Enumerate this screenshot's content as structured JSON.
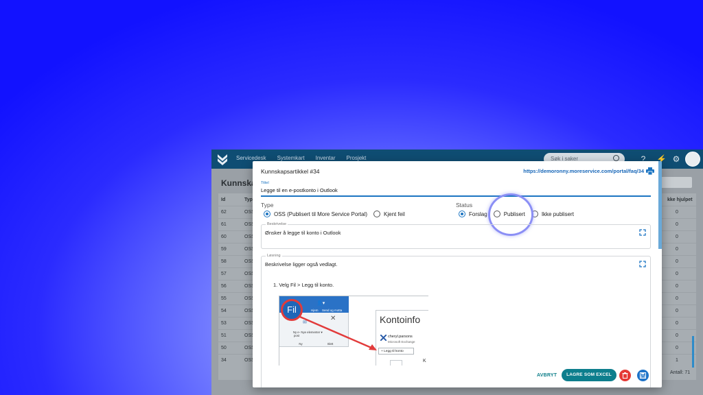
{
  "app": {
    "nav": [
      "Servicedesk",
      "Systemkart",
      "Inventar",
      "Prosjekt"
    ],
    "search_placeholder": "Søk i saker",
    "page_title": "Kunnskap",
    "table": {
      "headers": [
        "Id",
        "Typ",
        "kke hjulpet"
      ],
      "rows": [
        {
          "id": "62",
          "type": "OSS",
          "val": "0"
        },
        {
          "id": "61",
          "type": "OSS",
          "val": "0"
        },
        {
          "id": "60",
          "type": "OSS",
          "val": "0"
        },
        {
          "id": "59",
          "type": "OSS",
          "val": "0"
        },
        {
          "id": "58",
          "type": "OSS",
          "val": "0"
        },
        {
          "id": "57",
          "type": "OSS",
          "val": "0"
        },
        {
          "id": "56",
          "type": "OSS",
          "val": "0"
        },
        {
          "id": "55",
          "type": "OSS",
          "val": "0"
        },
        {
          "id": "54",
          "type": "OSS",
          "val": "0"
        },
        {
          "id": "53",
          "type": "OSS",
          "val": "0"
        },
        {
          "id": "51",
          "type": "OSS",
          "val": "0"
        },
        {
          "id": "50",
          "type": "OSS",
          "val": "0"
        },
        {
          "id": "34",
          "type": "OSS",
          "val": "1"
        }
      ],
      "count": "Antall: 71"
    }
  },
  "modal": {
    "title": "Kunnskapsartikkel #34",
    "url": "https://demoronny.moreservice.com/portal/faq/34",
    "tittel_label": "Tittel",
    "tittel_value": "Legge til en e-postkonto i Outlook",
    "type_label": "Type",
    "type_options": [
      {
        "label": "OSS (Publisert til More Service Portal)",
        "selected": true
      },
      {
        "label": "Kjent feil",
        "selected": false
      }
    ],
    "status_label": "Status",
    "status_options": [
      {
        "label": "Forslag",
        "selected": true
      },
      {
        "label": "Publisert",
        "selected": false
      },
      {
        "label": "Ikke publisert",
        "selected": false
      }
    ],
    "beskrivelse_label": "Beskrivelse",
    "beskrivelse_value": "Ønsker å legge til konto i Outlook",
    "losning_label": "Løsning",
    "losning_intro": "Beskrivelse ligger også vedlagt.",
    "losning_step": "1. Velg Fil > Legg til konto.",
    "screenshot": {
      "fil": "Fil",
      "tab_hjem": "Hjem",
      "tab_send": "Send og motta",
      "ny_epost": "Ny e-post",
      "nye_elementer": "Nye elementer ▾",
      "group_ny": "Ny",
      "group_slett": "Slett",
      "konto_title": "Kontoinfo",
      "konto_user": "cheryl.parsons",
      "konto_sub": "Microsoft Exchange",
      "konto_button": "Legg til konto",
      "konto_k": "K"
    },
    "actions": {
      "cancel": "AVBRYT",
      "excel": "LAGRE SOM EXCEL"
    }
  },
  "colors": {
    "accent": "#1b74c2",
    "teal": "#0d7e8d",
    "danger": "#e53935",
    "topbar": "#0f4d73"
  }
}
